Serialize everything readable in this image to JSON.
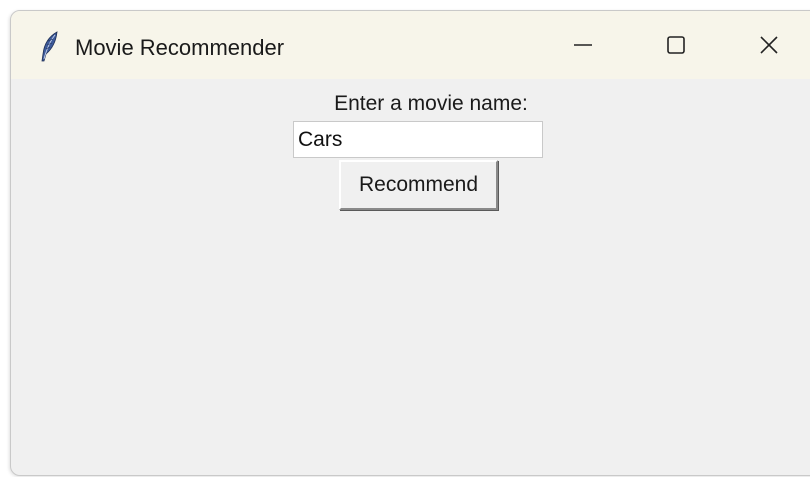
{
  "window": {
    "title": "Movie Recommender",
    "app_icon": "feather-icon",
    "controls": {
      "minimize_icon": "minimize-icon",
      "maximize_icon": "maximize-icon",
      "close_icon": "close-icon"
    }
  },
  "form": {
    "prompt_label": "Enter a movie name:",
    "movie_input_value": "Cars",
    "recommend_label": "Recommend"
  },
  "colors": {
    "titlebar": "#f7f5ea",
    "client_background": "#f0f0f0",
    "input_background": "#ffffff",
    "feather_blue": "#3d5a9a"
  }
}
